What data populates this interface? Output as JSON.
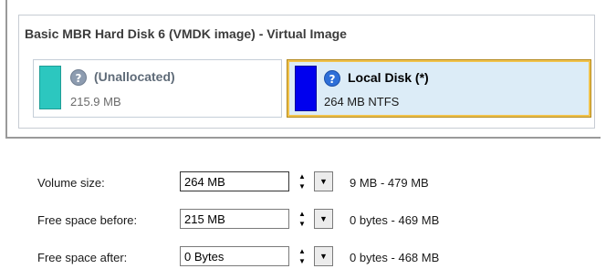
{
  "disk": {
    "title": "Basic MBR Hard Disk 6 (VMDK image) - Virtual Image",
    "partitions": [
      {
        "name": "(Unallocated)",
        "size": "215.9 MB",
        "color": "#2cc7bf",
        "icon": "question-icon"
      },
      {
        "name": "Local Disk (*)",
        "size": "264 MB NTFS",
        "color": "#0000ee",
        "icon": "question-icon",
        "selected": true
      }
    ]
  },
  "form": {
    "volume_size": {
      "label": "Volume size:",
      "value": "264 MB",
      "range": "9 MB - 479 MB"
    },
    "free_before": {
      "label": "Free space before:",
      "value": "215 MB",
      "range": "0 bytes - 469 MB"
    },
    "free_after": {
      "label": "Free space after:",
      "value": "0 Bytes",
      "range": "0 bytes - 468 MB"
    }
  },
  "icons": {
    "spin_up": "▲",
    "spin_down": "▼",
    "dropdown": "▼",
    "question": "?"
  }
}
